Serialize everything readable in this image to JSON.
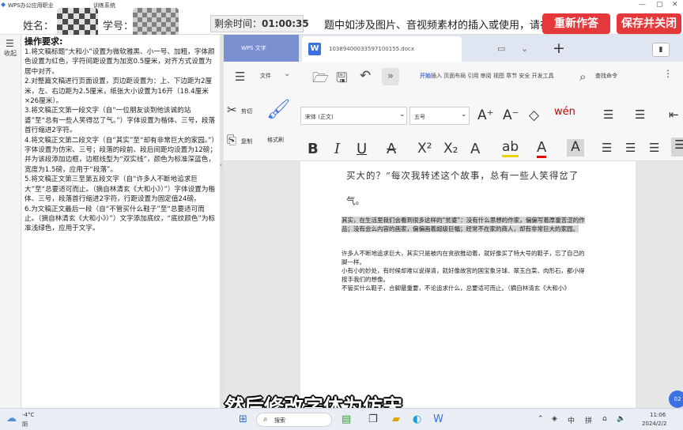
{
  "title_bar": {
    "app_title": "WPS办公应用职业",
    "app_title_tail": "训练系统"
  },
  "exam_header": {
    "name_label": "姓名：",
    "id_label": "学号：",
    "timer_label": "剩余时间：",
    "timer_value": "01:00:35",
    "notice": "题中如涉及图片、音视频素材的插入或使用，请在",
    "redo_button": "重新作答",
    "save_button": "保存并关闭"
  },
  "instructions": {
    "collapse_label": "收起",
    "heading": "操作要求:",
    "items": [
      "1.将文稿标题“大和小”设置为微软雅黑、小一号、加粗，字体颜色设置为红色，字符间距设置为加宽0.5厘米，对齐方式设置为居中对齐。",
      "2.对整篇文稿进行页面设置，页边距设置为：上、下边距为2厘米，左、右边距为2.5厘米，纸张大小设置为16开（18.4厘米×26厘米）。",
      "3.将文稿正文第一段文字（自“一位朋友谈到他该诚的站婆”至“总有一些人笑得岔了气。”）字体设置为楷体、三号，段落首行缩进2字符。",
      "4.将文稿正文第二段文字（自“其实”至“却有非常巨大的家园。”）字体设置为仿宋、三号；段落的段前、段后间距均设置为12磅；并为该段添加边框，边框线型为“双实线”，颜色为标准深蓝色，宽度为1.5磅，应用于“段落”。",
      "5.将文稿正文第三至第五段文字（自“许多人不断地追求巨大”至“总要适可而止。（摘自林清玄《大和小》）”）字体设置为楷体、三号，段落首行缩进2字符，行距设置为固定值24磅。",
      "6.为文稿正文最后一段（自“不管买什么鞋子”至“总要适可而止。（摘自林清玄《大和小》）”）文字添加底纹，“底纹颜色”为标准浅绿色，应用于文字。"
    ]
  },
  "wps": {
    "brand": "WPS 文字",
    "doc_tab": "10389400033597100155.docx",
    "menu": {
      "file": "文件",
      "start": "开始",
      "others": "插入 页面布局 引用 审阅 视图 章节 安全 开发工具",
      "search": "查找命令"
    },
    "ribbon": {
      "cut": "剪切",
      "copy": "复制",
      "format_painter": "格式刷",
      "font_name": "宋体 (正文)",
      "font_size": "五号",
      "wen": "wén"
    }
  },
  "document": {
    "line1": "买大的？”每次我转述这个故事，总有一些人笑得岔了",
    "line2": "气。",
    "para2_highlighted": "其实，在生活里我们会看到很多这样的“贫婆”：没有什么思想的作家，偏偏写着厚重苦涩的作品；没有会么内容的画家，偏偏画着超级巨幅；经常不在家的商人，却有非常巨大的家园。",
    "para3": "许多人不断地追求巨大，其实只是被内在贪欲推动着，就好像买了特大号的鞋子，忘了自己的脚一样。",
    "para4": "小有小的妙处，有时候却难以说得清，就好像故宫的国宝象牙球、翠玉白菜、肉形石，都小得按手我们的想像。",
    "para5": "不管买什么鞋子，合脚最重要，不论追求什么，总要适可而止。（摘自林清玄《大和小》"
  },
  "subtitle": "然后修改字体为仿宋",
  "taskbar": {
    "weather_temp": "-4°C",
    "weather_text": "阴",
    "search_placeholder": "搜索",
    "ime_lang": "中",
    "ime_mode": "拼",
    "time": "11:06",
    "date": "2024/2/2",
    "bubble": "02"
  }
}
